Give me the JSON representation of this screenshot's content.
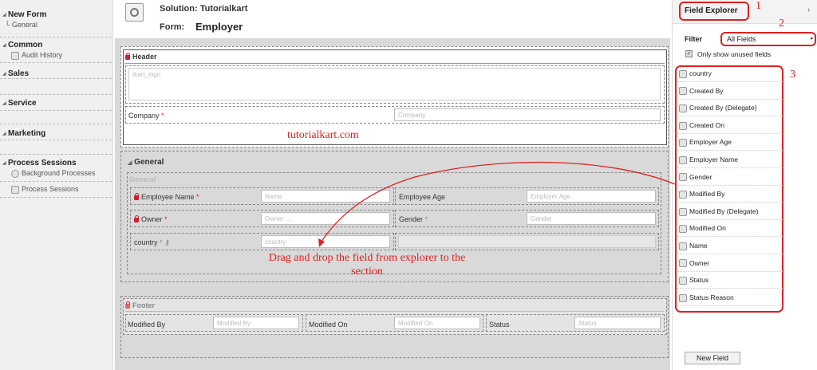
{
  "nav": {
    "form_title": "New Form",
    "form_sub": "General",
    "groups": [
      {
        "label": "Common",
        "items": [
          "Audit History"
        ]
      },
      {
        "label": "Sales",
        "items": []
      },
      {
        "label": "Service",
        "items": []
      },
      {
        "label": "Marketing",
        "items": []
      },
      {
        "label": "Process Sessions",
        "items": [
          "Background Processes",
          "Process Sessions"
        ]
      }
    ]
  },
  "topbar": {
    "solution_label": "Solution: Tutorialkart",
    "form_label": "Form:",
    "form_name": "Employer"
  },
  "header_section": {
    "title": "Header",
    "logo_placeholder": "tkart_logo",
    "company_label": "Company",
    "company_req": "*",
    "company_placeholder": "Company"
  },
  "watermark": "tutorialkart.com",
  "general_tab": {
    "title": "General",
    "section_title": "General",
    "rows": [
      {
        "left_label": "Employee Name",
        "left_req": "*",
        "left_placeholder": "Name",
        "right_label": "Employee Age",
        "right_req": "",
        "right_placeholder": "Employer Age"
      },
      {
        "left_label": "Owner",
        "left_req": "*",
        "left_placeholder": "Owner ...",
        "right_label": "Gender",
        "right_req": "*",
        "right_placeholder": "Gender"
      },
      {
        "left_label": "country",
        "left_req": "*",
        "left_placeholder": "country",
        "right_label": "",
        "right_req": "",
        "right_placeholder": ""
      }
    ]
  },
  "instruction": {
    "line1": "Drag and drop the field from explorer to the",
    "line2": "section"
  },
  "footer_section": {
    "title": "Footer",
    "fields": [
      {
        "label": "Modified By",
        "placeholder": "Modified By"
      },
      {
        "label": "Modified On",
        "placeholder": "Modified On"
      },
      {
        "label": "Status",
        "placeholder": "Status"
      }
    ]
  },
  "explorer": {
    "title": "Field Explorer",
    "filter_label": "Filter",
    "filter_value": "All Fields",
    "unused_label": "Only show unused fields",
    "fields": [
      "country",
      "Created By",
      "Created By (Delegate)",
      "Created On",
      "Employer Age",
      "Employer Name",
      "Gender",
      "Modified By",
      "Modified By (Delegate)",
      "Modified On",
      "Name",
      "Owner",
      "Status",
      "Status Reason"
    ],
    "new_field_button": "New Field"
  },
  "annotations": {
    "n1": "1",
    "n2": "2",
    "n3": "3"
  },
  "colors": {
    "annotation_red": "#dd2222",
    "lock_red": "#cc2233",
    "canvas_gray": "#d9d9d9"
  }
}
